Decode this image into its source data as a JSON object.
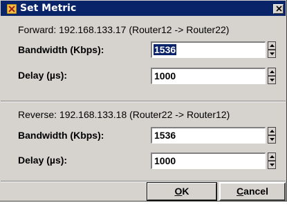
{
  "window": {
    "title": "Set Metric"
  },
  "forward": {
    "heading": "Forward: 192.168.133.17 (Router12 -> Router22)",
    "bandwidth_label": "Bandwidth (Kbps):",
    "bandwidth_value": "1536",
    "delay_label": "Delay (µs):",
    "delay_value": "1000"
  },
  "reverse": {
    "heading": "Reverse: 192.168.133.18 (Router22 -> Router12)",
    "bandwidth_label": "Bandwidth (Kbps):",
    "bandwidth_value": "1536",
    "delay_label": "Delay (µs):",
    "delay_value": "1000"
  },
  "buttons": {
    "ok_mnemonic": "O",
    "ok_rest": "K",
    "cancel_mnemonic": "C",
    "cancel_rest": "ancel"
  },
  "colors": {
    "title_bar": "#0a246a",
    "selection": "#0a246a",
    "dialog_face": "#d6d3ce"
  }
}
